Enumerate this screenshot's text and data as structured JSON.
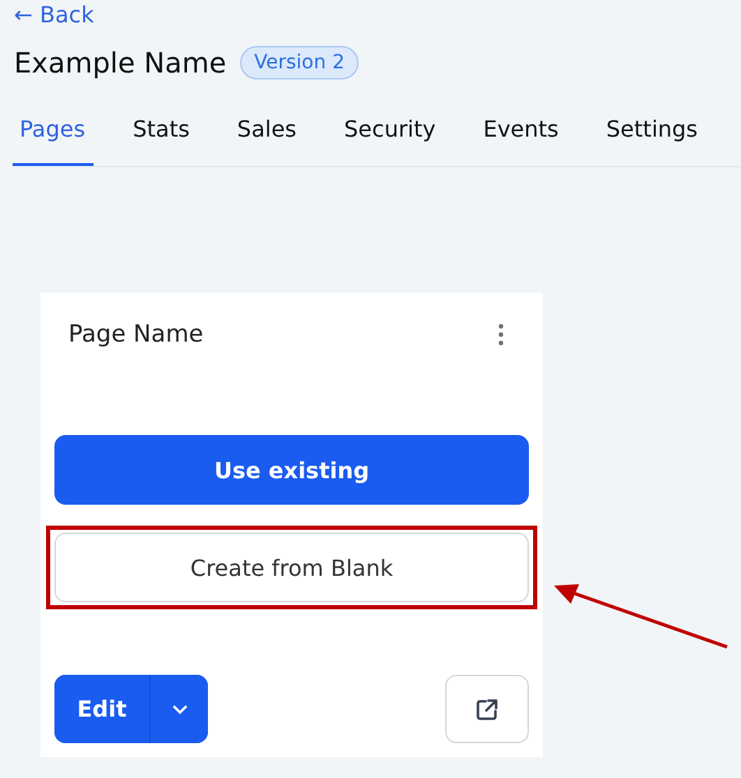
{
  "back_link": {
    "icon": "←",
    "label": "Back"
  },
  "title": "Example Name",
  "badge": "Version 2",
  "tabs": [
    {
      "label": "Pages",
      "selected": true
    },
    {
      "label": "Stats",
      "selected": false
    },
    {
      "label": "Sales",
      "selected": false
    },
    {
      "label": "Security",
      "selected": false
    },
    {
      "label": "Events",
      "selected": false
    },
    {
      "label": "Settings",
      "selected": false
    }
  ],
  "card": {
    "title": "Page Name",
    "primary_button": "Use existing",
    "secondary_button": "Create from Blank",
    "secondary_highlighted": true,
    "edit_button": "Edit"
  }
}
